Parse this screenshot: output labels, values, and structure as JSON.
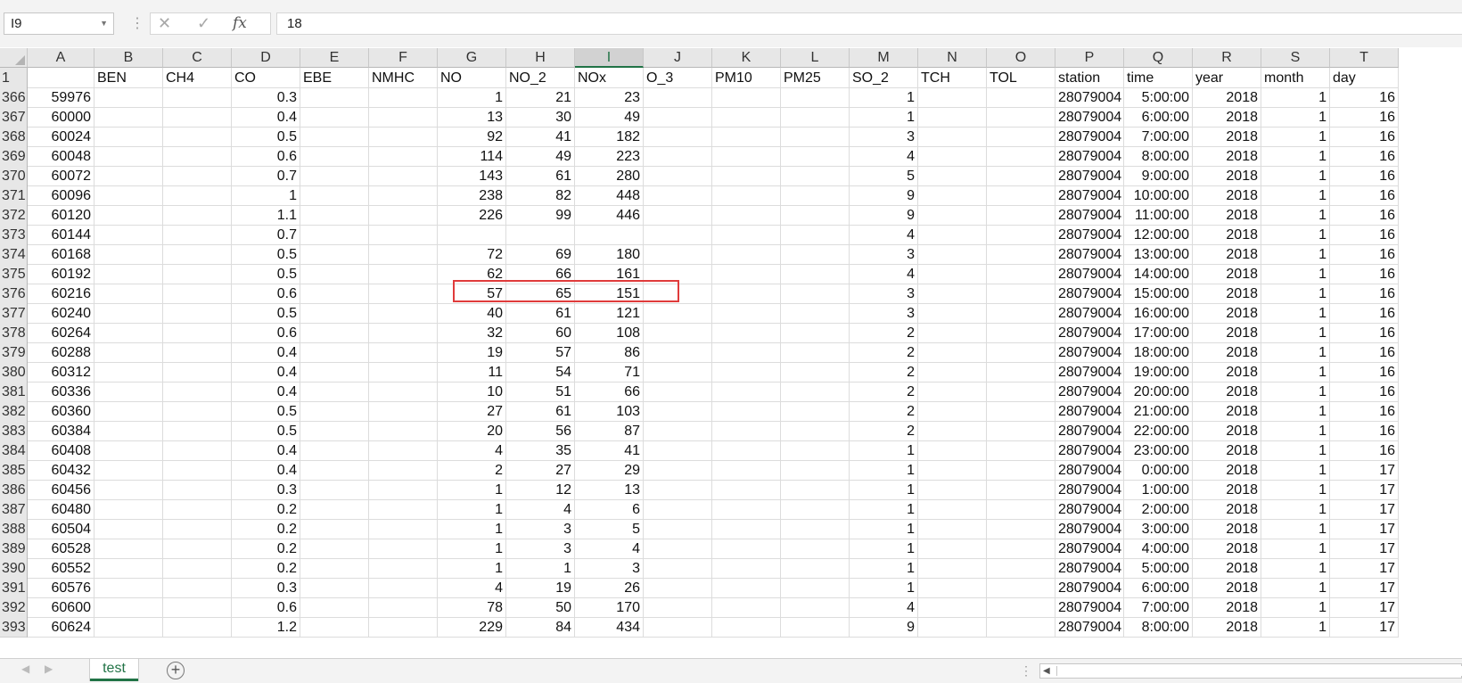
{
  "formula_bar": {
    "name_box": "I9",
    "cancel_icon": "✕",
    "enter_icon": "✓",
    "fx_label": "fx",
    "formula_value": "18"
  },
  "columns": [
    "A",
    "B",
    "C",
    "D",
    "E",
    "F",
    "G",
    "H",
    "I",
    "J",
    "K",
    "L",
    "M",
    "N",
    "O",
    "P",
    "Q",
    "R",
    "S",
    "T"
  ],
  "selected_column": "I",
  "header_row": {
    "number": "1",
    "cells": [
      "",
      "BEN",
      "CH4",
      "CO",
      "EBE",
      "NMHC",
      "NO",
      "NO_2",
      "NOx",
      "O_3",
      "PM10",
      "PM25",
      "SO_2",
      "TCH",
      "TOL",
      "station",
      "time",
      "year",
      "month",
      "day"
    ]
  },
  "rows": [
    {
      "n": "366",
      "A": "59976",
      "D": "0.3",
      "G": "1",
      "H": "21",
      "I": "23",
      "M": "1",
      "P": "28079004",
      "Q": "5:00:00",
      "R": "2018",
      "S": "1",
      "T": "16"
    },
    {
      "n": "367",
      "A": "60000",
      "D": "0.4",
      "G": "13",
      "H": "30",
      "I": "49",
      "M": "1",
      "P": "28079004",
      "Q": "6:00:00",
      "R": "2018",
      "S": "1",
      "T": "16"
    },
    {
      "n": "368",
      "A": "60024",
      "D": "0.5",
      "G": "92",
      "H": "41",
      "I": "182",
      "M": "3",
      "P": "28079004",
      "Q": "7:00:00",
      "R": "2018",
      "S": "1",
      "T": "16"
    },
    {
      "n": "369",
      "A": "60048",
      "D": "0.6",
      "G": "114",
      "H": "49",
      "I": "223",
      "M": "4",
      "P": "28079004",
      "Q": "8:00:00",
      "R": "2018",
      "S": "1",
      "T": "16"
    },
    {
      "n": "370",
      "A": "60072",
      "D": "0.7",
      "G": "143",
      "H": "61",
      "I": "280",
      "M": "5",
      "P": "28079004",
      "Q": "9:00:00",
      "R": "2018",
      "S": "1",
      "T": "16"
    },
    {
      "n": "371",
      "A": "60096",
      "D": "1",
      "G": "238",
      "H": "82",
      "I": "448",
      "M": "9",
      "P": "28079004",
      "Q": "10:00:00",
      "R": "2018",
      "S": "1",
      "T": "16"
    },
    {
      "n": "372",
      "A": "60120",
      "D": "1.1",
      "G": "226",
      "H": "99",
      "I": "446",
      "M": "9",
      "P": "28079004",
      "Q": "11:00:00",
      "R": "2018",
      "S": "1",
      "T": "16"
    },
    {
      "n": "373",
      "A": "60144",
      "D": "0.7",
      "G": "",
      "H": "",
      "I": "",
      "M": "4",
      "P": "28079004",
      "Q": "12:00:00",
      "R": "2018",
      "S": "1",
      "T": "16"
    },
    {
      "n": "374",
      "A": "60168",
      "D": "0.5",
      "G": "72",
      "H": "69",
      "I": "180",
      "M": "3",
      "P": "28079004",
      "Q": "13:00:00",
      "R": "2018",
      "S": "1",
      "T": "16"
    },
    {
      "n": "375",
      "A": "60192",
      "D": "0.5",
      "G": "62",
      "H": "66",
      "I": "161",
      "M": "4",
      "P": "28079004",
      "Q": "14:00:00",
      "R": "2018",
      "S": "1",
      "T": "16"
    },
    {
      "n": "376",
      "A": "60216",
      "D": "0.6",
      "G": "57",
      "H": "65",
      "I": "151",
      "M": "3",
      "P": "28079004",
      "Q": "15:00:00",
      "R": "2018",
      "S": "1",
      "T": "16"
    },
    {
      "n": "377",
      "A": "60240",
      "D": "0.5",
      "G": "40",
      "H": "61",
      "I": "121",
      "M": "3",
      "P": "28079004",
      "Q": "16:00:00",
      "R": "2018",
      "S": "1",
      "T": "16"
    },
    {
      "n": "378",
      "A": "60264",
      "D": "0.6",
      "G": "32",
      "H": "60",
      "I": "108",
      "M": "2",
      "P": "28079004",
      "Q": "17:00:00",
      "R": "2018",
      "S": "1",
      "T": "16"
    },
    {
      "n": "379",
      "A": "60288",
      "D": "0.4",
      "G": "19",
      "H": "57",
      "I": "86",
      "M": "2",
      "P": "28079004",
      "Q": "18:00:00",
      "R": "2018",
      "S": "1",
      "T": "16"
    },
    {
      "n": "380",
      "A": "60312",
      "D": "0.4",
      "G": "11",
      "H": "54",
      "I": "71",
      "M": "2",
      "P": "28079004",
      "Q": "19:00:00",
      "R": "2018",
      "S": "1",
      "T": "16"
    },
    {
      "n": "381",
      "A": "60336",
      "D": "0.4",
      "G": "10",
      "H": "51",
      "I": "66",
      "M": "2",
      "P": "28079004",
      "Q": "20:00:00",
      "R": "2018",
      "S": "1",
      "T": "16"
    },
    {
      "n": "382",
      "A": "60360",
      "D": "0.5",
      "G": "27",
      "H": "61",
      "I": "103",
      "M": "2",
      "P": "28079004",
      "Q": "21:00:00",
      "R": "2018",
      "S": "1",
      "T": "16"
    },
    {
      "n": "383",
      "A": "60384",
      "D": "0.5",
      "G": "20",
      "H": "56",
      "I": "87",
      "M": "2",
      "P": "28079004",
      "Q": "22:00:00",
      "R": "2018",
      "S": "1",
      "T": "16"
    },
    {
      "n": "384",
      "A": "60408",
      "D": "0.4",
      "G": "4",
      "H": "35",
      "I": "41",
      "M": "1",
      "P": "28079004",
      "Q": "23:00:00",
      "R": "2018",
      "S": "1",
      "T": "16"
    },
    {
      "n": "385",
      "A": "60432",
      "D": "0.4",
      "G": "2",
      "H": "27",
      "I": "29",
      "M": "1",
      "P": "28079004",
      "Q": "0:00:00",
      "R": "2018",
      "S": "1",
      "T": "17"
    },
    {
      "n": "386",
      "A": "60456",
      "D": "0.3",
      "G": "1",
      "H": "12",
      "I": "13",
      "M": "1",
      "P": "28079004",
      "Q": "1:00:00",
      "R": "2018",
      "S": "1",
      "T": "17"
    },
    {
      "n": "387",
      "A": "60480",
      "D": "0.2",
      "G": "1",
      "H": "4",
      "I": "6",
      "M": "1",
      "P": "28079004",
      "Q": "2:00:00",
      "R": "2018",
      "S": "1",
      "T": "17"
    },
    {
      "n": "388",
      "A": "60504",
      "D": "0.2",
      "G": "1",
      "H": "3",
      "I": "5",
      "M": "1",
      "P": "28079004",
      "Q": "3:00:00",
      "R": "2018",
      "S": "1",
      "T": "17"
    },
    {
      "n": "389",
      "A": "60528",
      "D": "0.2",
      "G": "1",
      "H": "3",
      "I": "4",
      "M": "1",
      "P": "28079004",
      "Q": "4:00:00",
      "R": "2018",
      "S": "1",
      "T": "17"
    },
    {
      "n": "390",
      "A": "60552",
      "D": "0.2",
      "G": "1",
      "H": "1",
      "I": "3",
      "M": "1",
      "P": "28079004",
      "Q": "5:00:00",
      "R": "2018",
      "S": "1",
      "T": "17"
    },
    {
      "n": "391",
      "A": "60576",
      "D": "0.3",
      "G": "4",
      "H": "19",
      "I": "26",
      "M": "1",
      "P": "28079004",
      "Q": "6:00:00",
      "R": "2018",
      "S": "1",
      "T": "17"
    },
    {
      "n": "392",
      "A": "60600",
      "D": "0.6",
      "G": "78",
      "H": "50",
      "I": "170",
      "M": "4",
      "P": "28079004",
      "Q": "7:00:00",
      "R": "2018",
      "S": "1",
      "T": "17"
    },
    {
      "n": "393",
      "A": "60624",
      "D": "1.2",
      "G": "229",
      "H": "84",
      "I": "434",
      "M": "9",
      "P": "28079004",
      "Q": "8:00:00",
      "R": "2018",
      "S": "1",
      "T": "17"
    }
  ],
  "sheet_tabs": [
    {
      "label": "test",
      "active": true
    }
  ],
  "add_sheet_label": "+",
  "colors": {
    "excel_green": "#217346",
    "selection_red": "#e03b3b",
    "header_gray": "#e7e7e7"
  }
}
